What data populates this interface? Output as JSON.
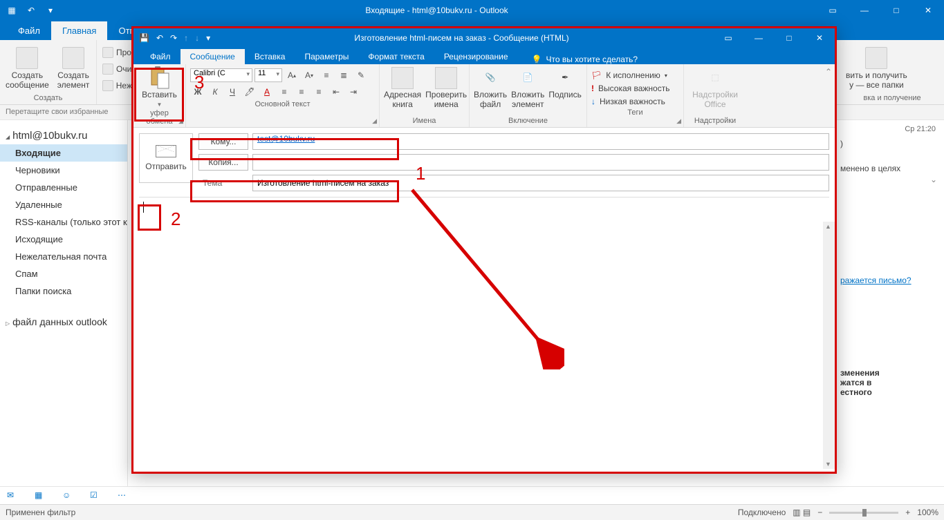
{
  "main": {
    "title": "Входящие - html@10bukv.ru - Outlook",
    "tabs": [
      "Файл",
      "Главная",
      "Отпр"
    ],
    "active_tab": 1,
    "fav_hint": "Перетащите свои избранные",
    "ribbon": {
      "g1": {
        "btn1": "Создать\nсообщение",
        "btn2": "Создать\nэлемент",
        "label": "Создать"
      },
      "g2": {
        "i1": "Про",
        "i2": "Очи",
        "i3": "Неж"
      },
      "g3": {
        "btn": "вить и получить\nу — все папки",
        "label": "вка и получение"
      }
    },
    "account": "html@10bukv.ru",
    "folders": [
      "Входящие",
      "Черновики",
      "Отправленные",
      "Удаленные",
      "RSS-каналы (только этот ком",
      "Исходящие",
      "Нежелательная почта",
      "Спам",
      "Папки поиска"
    ],
    "active_folder": 0,
    "account2": "файл данных outlook",
    "status_left": "Применен фильтр",
    "status_conn": "Подключено",
    "zoom": "100%",
    "read": {
      "date": "Ср 21:20",
      "frag1": ")",
      "frag2": "менено в целях",
      "link": "ражается письмо?",
      "frag3": "зменения",
      "frag4": "жатся в",
      "frag5": "естного"
    }
  },
  "compose": {
    "title": "Изготовление html-писем на заказ - Сообщение (HTML)",
    "tabs": [
      "Файл",
      "Сообщение",
      "Вставка",
      "Параметры",
      "Формат текста",
      "Рецензирование"
    ],
    "active_tab": 1,
    "tell_me": "Что вы хотите сделать?",
    "ribbon": {
      "clipboard": {
        "btn": "Вставить",
        "label": "уфер обмена"
      },
      "font": {
        "name": "Calibri (С",
        "size": "11",
        "label": "Основной текст"
      },
      "names": {
        "b1": "Адресная\nкнига",
        "b2": "Проверить\nимена",
        "label": "Имена"
      },
      "include": {
        "b1": "Вложить\nфайл",
        "b2": "Вложить\nэлемент",
        "b3": "Подпись",
        "label": "Включение"
      },
      "tags": {
        "t1": "К исполнению",
        "t2": "Высокая важность",
        "t3": "Низкая важность",
        "label": "Теги"
      },
      "addins": {
        "b1": "Надстройки\nOffice",
        "label": "Надстройки"
      }
    },
    "send": "Отправить",
    "to_label": "Кому...",
    "to_value": "test@10bukv.ru",
    "cc_label": "Копия...",
    "cc_value": "",
    "subject_label": "Тема",
    "subject_value": "Изготовление html-писем на заказ"
  },
  "annotations": {
    "n1": "1",
    "n2": "2",
    "n3": "3"
  }
}
